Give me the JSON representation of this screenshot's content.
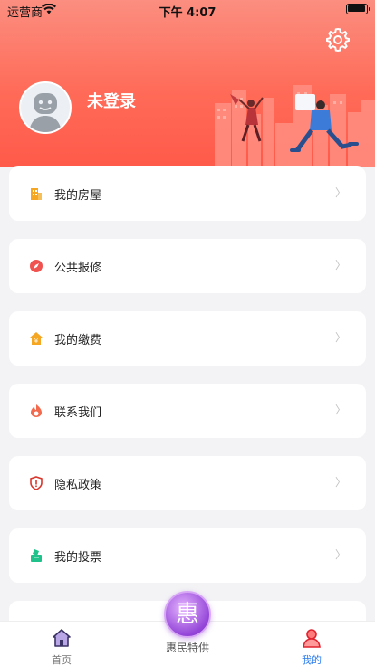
{
  "status_bar": {
    "carrier": "运营商",
    "time": "下午 4:07"
  },
  "profile": {
    "name": "未登录",
    "subtitle": "———"
  },
  "menu": [
    {
      "label": "我的房屋",
      "icon": "building-icon"
    },
    {
      "label": "公共报修",
      "icon": "repair-compass-icon"
    },
    {
      "label": "我的缴费",
      "icon": "payment-house-icon"
    },
    {
      "label": "联系我们",
      "icon": "contact-flame-icon"
    },
    {
      "label": "隐私政策",
      "icon": "privacy-shield-icon"
    },
    {
      "label": "我的投票",
      "icon": "vote-box-icon"
    }
  ],
  "chevron": "〉",
  "tabbar": {
    "home": "首页",
    "center_badge": "惠",
    "center_label": "惠民特供",
    "mine": "我的"
  },
  "colors": {
    "header": "#ff6b58",
    "active_tab": "#2a7cf0",
    "center_button": "#9446d8"
  }
}
